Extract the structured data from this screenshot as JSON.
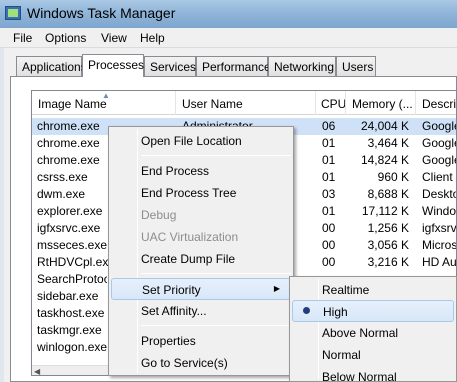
{
  "window": {
    "title": "Windows Task Manager"
  },
  "menubar": {
    "items": [
      "File",
      "Options",
      "View",
      "Help"
    ]
  },
  "tabs": [
    "Applications",
    "Processes",
    "Services",
    "Performance",
    "Networking",
    "Users"
  ],
  "active_tab": "Processes",
  "columns": [
    "Image Name",
    "User Name",
    "CPU",
    "Memory (...",
    "Descrip"
  ],
  "rows": [
    {
      "image": "chrome.exe",
      "user": "Administrator",
      "cpu": "06",
      "mem": "24,004 K",
      "desc": "Google"
    },
    {
      "image": "chrome.exe",
      "user": "",
      "cpu": "01",
      "mem": "3,464 K",
      "desc": "Google"
    },
    {
      "image": "chrome.exe",
      "user": "",
      "cpu": "01",
      "mem": "14,824 K",
      "desc": "Google"
    },
    {
      "image": "csrss.exe",
      "user": "",
      "cpu": "01",
      "mem": "960 K",
      "desc": "Client S"
    },
    {
      "image": "dwm.exe",
      "user": "",
      "cpu": "03",
      "mem": "8,688 K",
      "desc": "Desktop"
    },
    {
      "image": "explorer.exe",
      "user": "",
      "cpu": "01",
      "mem": "17,112 K",
      "desc": "Window"
    },
    {
      "image": "igfxsrvc.exe",
      "user": "",
      "cpu": "00",
      "mem": "1,256 K",
      "desc": "igfxsrv"
    },
    {
      "image": "msseces.exe",
      "user": "",
      "cpu": "00",
      "mem": "3,056 K",
      "desc": "Microsc"
    },
    {
      "image": "RtHDVCpl.exe",
      "user": "",
      "cpu": "00",
      "mem": "3,216 K",
      "desc": "HD Aud"
    },
    {
      "image": "SearchProtoco",
      "user": "",
      "cpu": "",
      "mem": "",
      "desc": ""
    },
    {
      "image": "sidebar.exe",
      "user": "",
      "cpu": "",
      "mem": "",
      "desc": ""
    },
    {
      "image": "taskhost.exe",
      "user": "",
      "cpu": "",
      "mem": "",
      "desc": ""
    },
    {
      "image": "taskmgr.exe",
      "user": "",
      "cpu": "",
      "mem": "",
      "desc": ""
    },
    {
      "image": "winlogon.exe",
      "user": "",
      "cpu": "",
      "mem": "",
      "desc": ""
    }
  ],
  "context_menu": {
    "open_file_location": "Open File Location",
    "end_process": "End Process",
    "end_process_tree": "End Process Tree",
    "debug": "Debug",
    "uac_virtualization": "UAC Virtualization",
    "create_dump_file": "Create Dump File",
    "set_priority": "Set Priority",
    "set_affinity": "Set Affinity...",
    "properties": "Properties",
    "go_to_services": "Go to Service(s)"
  },
  "priority_menu": {
    "realtime": "Realtime",
    "high": "High",
    "above_normal": "Above Normal",
    "normal": "Normal",
    "below_normal": "Below Normal"
  },
  "colors": {
    "selection": "#cfe1f6",
    "menu_highlight": "#d8e7f8",
    "titlebar": "#8fb4d8"
  }
}
